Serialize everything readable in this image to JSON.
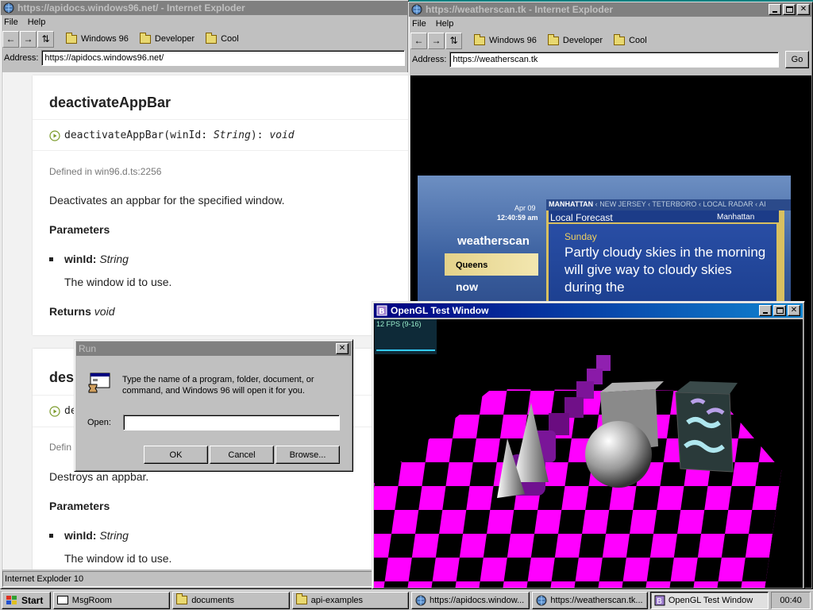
{
  "browser1": {
    "title": "https://apidocs.windows96.net/ - Internet Exploder",
    "menu": [
      "File",
      "Help"
    ],
    "favorites": [
      "Windows 96",
      "Developer",
      "Cool"
    ],
    "address_label": "Address:",
    "url": "https://apidocs.windows96.net/",
    "status": "Internet Exploder 10",
    "doc1": {
      "heading": "deactivateAppBar",
      "signature_name": "deactivateAppBar",
      "signature_param": "winId",
      "signature_type": "String",
      "signature_return": "void",
      "defined_in": "Defined in win96.d.ts:2256",
      "description": "Deactivates an appbar for the specified window.",
      "params_heading": "Parameters",
      "param_name": "winId:",
      "param_type": "String",
      "param_desc": "The window id to use.",
      "returns_label": "Returns",
      "returns_type": "void"
    },
    "doc2": {
      "heading_partial": "dest",
      "signature_partial": "de",
      "defined_partial": "Defin",
      "description": "Destroys an appbar.",
      "params_heading": "Parameters",
      "param_name": "winId:",
      "param_type": "String",
      "param_desc": "The window id to use."
    }
  },
  "browser2": {
    "title": "https://weatherscan.tk - Internet Exploder",
    "menu": [
      "File",
      "Help"
    ],
    "favorites": [
      "Windows 96",
      "Developer",
      "Cool"
    ],
    "address_label": "Address:",
    "url": "https://weatherscan.tk",
    "go_label": "Go",
    "weather": {
      "date": "Apr 09",
      "time": "12:40:59 am",
      "logo": "weatherscan",
      "city": "Queens",
      "now": "now",
      "ticker": [
        "MANHATTAN",
        "NEW JERSEY",
        "TETERBORO",
        "LOCAL RADAR",
        "AI"
      ],
      "panel_title": "Local Forecast",
      "panel_location": "Manhattan",
      "day": "Sunday",
      "forecast": "Partly cloudy skies in the morning will give way to cloudy skies during the"
    }
  },
  "run_dialog": {
    "title": "Run",
    "message": "Type the name of a program, folder, document, or command, and Windows 96 will open it for you.",
    "open_label": "Open:",
    "open_value": "",
    "ok": "OK",
    "cancel": "Cancel",
    "browse": "Browse..."
  },
  "gl_window": {
    "title": "OpenGL Test Window",
    "fps": "12 FPS (9-16)",
    "colors": {
      "checker_a": "#ff00ff",
      "checker_b": "#000000"
    }
  },
  "taskbar": {
    "start": "Start",
    "items": [
      "MsgRoom",
      "documents",
      "api-examples",
      "https://apidocs.window...",
      "https://weatherscan.tk...",
      "OpenGL Test Window"
    ],
    "clock": "00:40"
  }
}
